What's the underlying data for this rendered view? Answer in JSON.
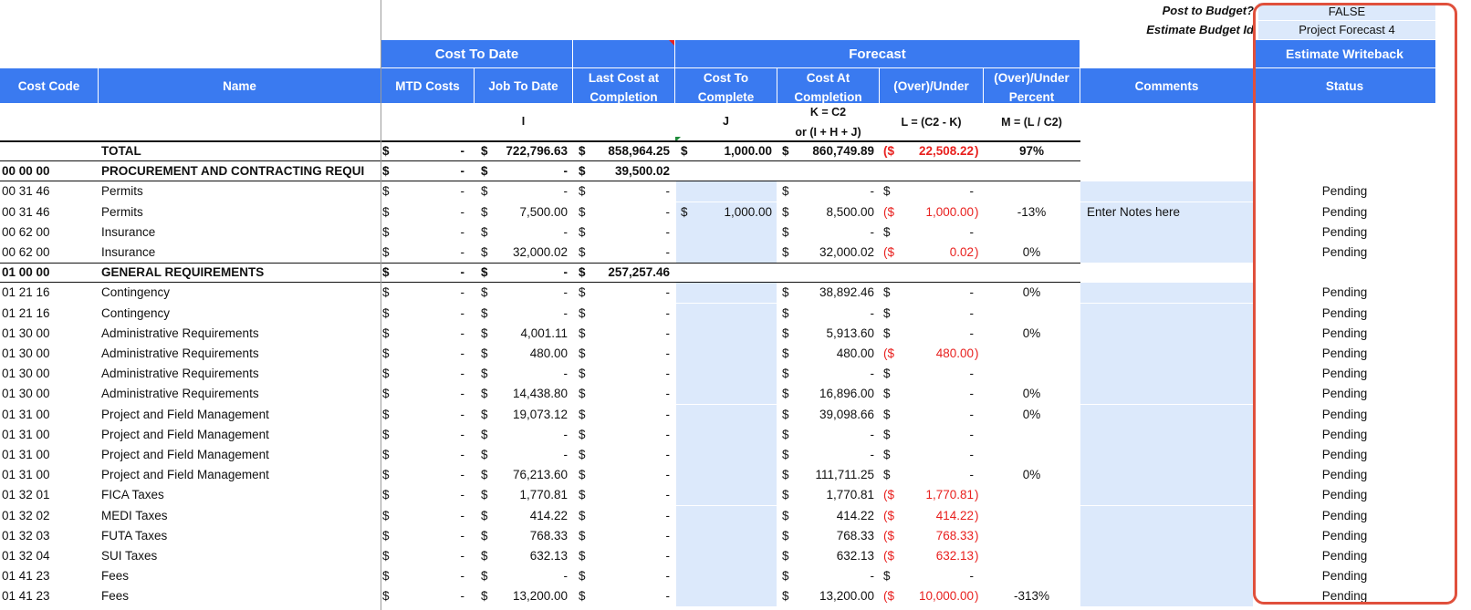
{
  "params": {
    "post_label": "Post to Budget?",
    "post_value": "FALSE",
    "estimate_label": "Estimate Budget Id",
    "estimate_value": "Project Forecast 4"
  },
  "groups": {
    "cost_to_date": "Cost To Date",
    "forecast": "Forecast",
    "writeback": "Estimate Writeback"
  },
  "headers": {
    "cost_code": "Cost Code",
    "name": "Name",
    "mtd": "MTD Costs",
    "jtd": "Job To Date",
    "last_cost_1": "Last Cost at",
    "last_cost_2": "Completion",
    "ctc_1": "Cost To",
    "ctc_2": "Complete",
    "cac_1": "Cost At",
    "cac_2": "Completion",
    "over_under": "(Over)/Under",
    "ou_pct_1": "(Over)/Under",
    "ou_pct_2": "Percent",
    "comments": "Comments",
    "status": "Status"
  },
  "formulas": {
    "i": "I",
    "j": "J",
    "k1": "K = C2",
    "k2": "or (I + H + J)",
    "l": "L = (C2 - K)",
    "m": "M = (L / C2)"
  },
  "rows": [
    {
      "code": "",
      "name": "TOTAL",
      "mtd": "-",
      "jtd": "722,796.63",
      "lcc": "858,964.25",
      "ctc": "1,000.00",
      "cac": "860,749.89",
      "ou": "22,508.22",
      "ou_neg": true,
      "pct": "97%",
      "comment": "",
      "status": "",
      "kind": "total"
    },
    {
      "code": "00 00 00",
      "name": "PROCUREMENT AND CONTRACTING REQUI",
      "mtd": "-",
      "jtd": "-",
      "lcc": "39,500.02",
      "ctc": "",
      "cac": "",
      "ou": "",
      "ou_neg": false,
      "pct": "",
      "comment": "",
      "status": "",
      "kind": "section"
    },
    {
      "code": "00 31 46",
      "name": "Permits",
      "mtd": "-",
      "jtd": "-",
      "lcc": "-",
      "ctc": "",
      "cac": "-",
      "ou": "-",
      "ou_neg": false,
      "pct": "",
      "comment": "",
      "status": "Pending",
      "kind": "line"
    },
    {
      "code": "00 31 46",
      "name": "Permits",
      "mtd": "-",
      "jtd": "7,500.00",
      "lcc": "-",
      "ctc": "1,000.00",
      "cac": "8,500.00",
      "ou": "1,000.00",
      "ou_neg": true,
      "pct": "-13%",
      "comment": "Enter Notes here",
      "status": "Pending",
      "kind": "line"
    },
    {
      "code": "00 62 00",
      "name": "Insurance",
      "mtd": "-",
      "jtd": "-",
      "lcc": "-",
      "ctc": "",
      "cac": "-",
      "ou": "-",
      "ou_neg": false,
      "pct": "",
      "comment": "",
      "status": "Pending",
      "kind": "line"
    },
    {
      "code": "00 62 00",
      "name": "Insurance",
      "mtd": "-",
      "jtd": "32,000.02",
      "lcc": "-",
      "ctc": "",
      "cac": "32,000.02",
      "ou": "0.02",
      "ou_neg": true,
      "pct": "0%",
      "comment": "",
      "status": "Pending",
      "kind": "line"
    },
    {
      "code": "01 00 00",
      "name": "GENERAL REQUIREMENTS",
      "mtd": "-",
      "jtd": "-",
      "lcc": "257,257.46",
      "ctc": "",
      "cac": "",
      "ou": "",
      "ou_neg": false,
      "pct": "",
      "comment": "",
      "status": "",
      "kind": "section"
    },
    {
      "code": "01 21 16",
      "name": "Contingency",
      "mtd": "-",
      "jtd": "-",
      "lcc": "-",
      "ctc": "",
      "cac": "38,892.46",
      "ou": "-",
      "ou_neg": false,
      "pct": "0%",
      "comment": "",
      "status": "Pending",
      "kind": "line"
    },
    {
      "code": "01 21 16",
      "name": "Contingency",
      "mtd": "-",
      "jtd": "-",
      "lcc": "-",
      "ctc": "",
      "cac": "-",
      "ou": "-",
      "ou_neg": false,
      "pct": "",
      "comment": "",
      "status": "Pending",
      "kind": "line"
    },
    {
      "code": "01 30 00",
      "name": "Administrative Requirements",
      "mtd": "-",
      "jtd": "4,001.11",
      "lcc": "-",
      "ctc": "",
      "cac": "5,913.60",
      "ou": "-",
      "ou_neg": false,
      "pct": "0%",
      "comment": "",
      "status": "Pending",
      "kind": "line"
    },
    {
      "code": "01 30 00",
      "name": "Administrative Requirements",
      "mtd": "-",
      "jtd": "480.00",
      "lcc": "-",
      "ctc": "",
      "cac": "480.00",
      "ou": "480.00",
      "ou_neg": true,
      "pct": "",
      "comment": "",
      "status": "Pending",
      "kind": "line"
    },
    {
      "code": "01 30 00",
      "name": "Administrative Requirements",
      "mtd": "-",
      "jtd": "-",
      "lcc": "-",
      "ctc": "",
      "cac": "-",
      "ou": "-",
      "ou_neg": false,
      "pct": "",
      "comment": "",
      "status": "Pending",
      "kind": "line"
    },
    {
      "code": "01 30 00",
      "name": "Administrative Requirements",
      "mtd": "-",
      "jtd": "14,438.80",
      "lcc": "-",
      "ctc": "",
      "cac": "16,896.00",
      "ou": "-",
      "ou_neg": false,
      "pct": "0%",
      "comment": "",
      "status": "Pending",
      "kind": "line"
    },
    {
      "code": "01 31 00",
      "name": "Project and Field Management",
      "mtd": "-",
      "jtd": "19,073.12",
      "lcc": "-",
      "ctc": "",
      "cac": "39,098.66",
      "ou": "-",
      "ou_neg": false,
      "pct": "0%",
      "comment": "",
      "status": "Pending",
      "kind": "line"
    },
    {
      "code": "01 31 00",
      "name": "Project and Field Management",
      "mtd": "-",
      "jtd": "-",
      "lcc": "-",
      "ctc": "",
      "cac": "-",
      "ou": "-",
      "ou_neg": false,
      "pct": "",
      "comment": "",
      "status": "Pending",
      "kind": "line"
    },
    {
      "code": "01 31 00",
      "name": "Project and Field Management",
      "mtd": "-",
      "jtd": "-",
      "lcc": "-",
      "ctc": "",
      "cac": "-",
      "ou": "-",
      "ou_neg": false,
      "pct": "",
      "comment": "",
      "status": "Pending",
      "kind": "line"
    },
    {
      "code": "01 31 00",
      "name": "Project and Field Management",
      "mtd": "-",
      "jtd": "76,213.60",
      "lcc": "-",
      "ctc": "",
      "cac": "111,711.25",
      "ou": "-",
      "ou_neg": false,
      "pct": "0%",
      "comment": "",
      "status": "Pending",
      "kind": "line"
    },
    {
      "code": "01 32 01",
      "name": "FICA Taxes",
      "mtd": "-",
      "jtd": "1,770.81",
      "lcc": "-",
      "ctc": "",
      "cac": "1,770.81",
      "ou": "1,770.81",
      "ou_neg": true,
      "pct": "",
      "comment": "",
      "status": "Pending",
      "kind": "line"
    },
    {
      "code": "01 32 02",
      "name": "MEDI Taxes",
      "mtd": "-",
      "jtd": "414.22",
      "lcc": "-",
      "ctc": "",
      "cac": "414.22",
      "ou": "414.22",
      "ou_neg": true,
      "pct": "",
      "comment": "",
      "status": "Pending",
      "kind": "line"
    },
    {
      "code": "01 32 03",
      "name": "FUTA Taxes",
      "mtd": "-",
      "jtd": "768.33",
      "lcc": "-",
      "ctc": "",
      "cac": "768.33",
      "ou": "768.33",
      "ou_neg": true,
      "pct": "",
      "comment": "",
      "status": "Pending",
      "kind": "line"
    },
    {
      "code": "01 32 04",
      "name": "SUI Taxes",
      "mtd": "-",
      "jtd": "632.13",
      "lcc": "-",
      "ctc": "",
      "cac": "632.13",
      "ou": "632.13",
      "ou_neg": true,
      "pct": "",
      "comment": "",
      "status": "Pending",
      "kind": "line"
    },
    {
      "code": "01 41 23",
      "name": "Fees",
      "mtd": "-",
      "jtd": "-",
      "lcc": "-",
      "ctc": "",
      "cac": "-",
      "ou": "-",
      "ou_neg": false,
      "pct": "",
      "comment": "",
      "status": "Pending",
      "kind": "line"
    },
    {
      "code": "01 41 23",
      "name": "Fees",
      "mtd": "-",
      "jtd": "13,200.00",
      "lcc": "-",
      "ctc": "",
      "cac": "13,200.00",
      "ou": "10,000.00",
      "ou_neg": true,
      "pct": "-313%",
      "comment": "",
      "status": "Pending",
      "kind": "line"
    }
  ],
  "currency_symbol": "$",
  "neg_prefix": "($",
  "neg_suffix": ")",
  "colors": {
    "header": "#3a7af0",
    "input_fill": "#dce9fb",
    "negative": "#e8201e",
    "highlight_border": "#e0503c"
  }
}
